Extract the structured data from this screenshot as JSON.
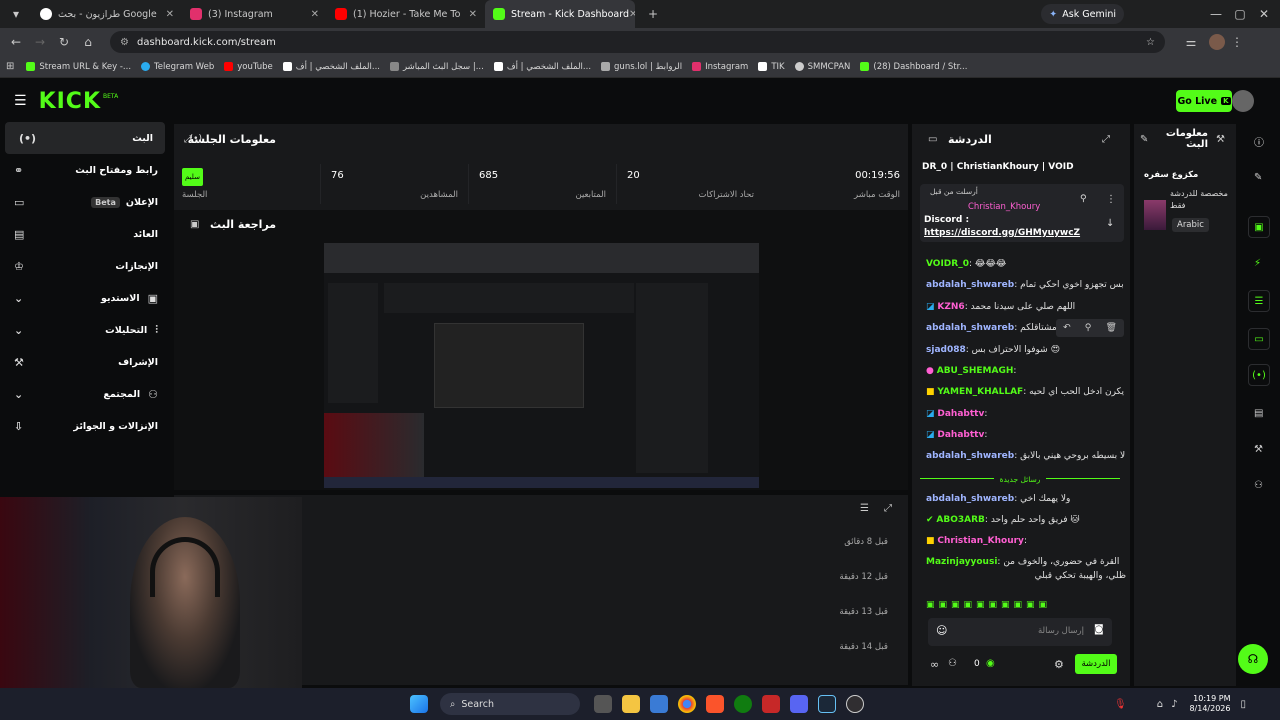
{
  "browser": {
    "tabs": [
      {
        "title": "طرازيون - بحث Google",
        "color": "#ffffff"
      },
      {
        "title": "(3) Instagram",
        "color": "#e1306c"
      },
      {
        "title": "(1) Hozier - Take Me To Ch...",
        "color": "#ff0000"
      },
      {
        "title": "Stream - Kick Dashboard",
        "color": "#53fc18"
      }
    ],
    "ask_gemini": "Ask Gemini",
    "url": "dashboard.kick.com/stream",
    "bookmarks": [
      {
        "label": "Stream URL & Key -...",
        "color": "#53fc18"
      },
      {
        "label": "Telegram Web",
        "color": "#2aabee"
      },
      {
        "label": "youTube",
        "color": "#ff0000"
      },
      {
        "label": "الملف الشخصي | أف...",
        "color": "#ffffff"
      },
      {
        "label": "سجل البث المباشر |...",
        "color": "#888888"
      },
      {
        "label": "الملف الشخصي | أف...",
        "color": "#ffffff"
      },
      {
        "label": "guns.lol | الروابط",
        "color": "#aaaaaa"
      },
      {
        "label": "Instagram",
        "color": "#e1306c"
      },
      {
        "label": "TIK",
        "color": "#ffffff"
      },
      {
        "label": "SMMCPAN",
        "color": "#cccccc"
      },
      {
        "label": "(28) Dashboard / Str...",
        "color": "#53fc18"
      }
    ]
  },
  "header": {
    "logo": "KICK",
    "beta": "BETA",
    "go_live": "Go Live"
  },
  "sidebar": {
    "items": [
      {
        "label": "البث",
        "icon": "live-icon"
      },
      {
        "label": "رابط ومفتاح البث",
        "icon": "link-icon"
      },
      {
        "label": "الإعلان",
        "icon": "ad-icon",
        "badge": "Beta"
      },
      {
        "label": "العائد",
        "icon": "revenue-icon"
      },
      {
        "label": "الإنجازات",
        "icon": "trophy-icon"
      },
      {
        "label": "الاستديو",
        "icon": "studio-icon"
      },
      {
        "label": "التحليلات",
        "icon": "analytics-icon"
      },
      {
        "label": "الإشراف",
        "icon": "moderation-icon"
      },
      {
        "label": "المجتمع",
        "icon": "community-icon"
      },
      {
        "label": "الإنزالات و الجوائز",
        "icon": "drops-icon"
      }
    ]
  },
  "session": {
    "title": "معلومات الجلسة",
    "stats": [
      {
        "value": "00:19:56",
        "label": "الوقت مباشر"
      },
      {
        "value": "20",
        "label": "تحاد الاشتراكات"
      },
      {
        "value": "685",
        "label": "المتابعين"
      },
      {
        "value": "76",
        "label": "المشاهدين"
      }
    ],
    "session_badge": "سليم",
    "session_label": "الجلسة"
  },
  "preview": {
    "title": "مراجعة البث"
  },
  "activity": {
    "rows": [
      "قبل 8 دقائق",
      "قبل 12 دقيقة",
      "قبل 13 دقيقة",
      "قبل 14 دقيقة"
    ]
  },
  "chat": {
    "title": "الدردشة",
    "top_users": "DR_0 | ChristianKhoury | VOID",
    "pinned_by": "أرسلت من قبل",
    "pinned_user": "Christian_Khoury",
    "pinned_text": "Discord :",
    "pinned_link": "https://discord.gg/GHMyuywcZ",
    "messages": [
      {
        "user": "VOIDR_0",
        "text": "😂😂😂",
        "color": "#53fc18"
      },
      {
        "user": "abdalah_shwareb",
        "text": "بس تجهزو اخوي احكي تمام",
        "color": "#9fb5ff"
      },
      {
        "user": "KZN6",
        "text": "اللهم صلي على سيدنا محمد",
        "color": "#ff5fd2"
      },
      {
        "user": "abdalah_shwareb",
        "text": "احنا مشتاقلكم",
        "color": "#9fb5ff"
      },
      {
        "user": "sjad088",
        "text": "شوفوا الاحتراف بس 😍",
        "color": "#9fb5ff"
      },
      {
        "user": "ABU_SHEMAGH",
        "text": "",
        "color": "#53fc18"
      },
      {
        "user": "YAMEN_KHALLAF",
        "text": "يكرن ادخل الحب اي لحيه",
        "color": "#53fc18"
      },
      {
        "user": "Dahabttv",
        "text": "",
        "color": "#ff5fd2"
      },
      {
        "user": "Dahabttv",
        "text": "",
        "color": "#ff5fd2"
      },
      {
        "user": "abdalah_shwareb",
        "text": "لا بسيطه بروحي هيني بالابق",
        "color": "#9fb5ff"
      },
      {
        "user": "abdalah_shwareb",
        "text": "ولا يهمك اخي",
        "color": "#9fb5ff"
      },
      {
        "user": "ABO3ARB",
        "text": "فريق واحد حلم واحد 🐱",
        "color": "#53fc18"
      },
      {
        "user": "Christian_Khoury",
        "text": "",
        "color": "#ff5fd2"
      },
      {
        "user": "Mazinjayyousi",
        "text": "القرة في حضوري، والخوف من",
        "color": "#53fc18"
      },
      {
        "user": "",
        "text": "ظلّي، والهيبة تحكي قبلي",
        "color": "#ffffff"
      }
    ],
    "new_messages": "رسائل جديدة",
    "input_placeholder": "إرسال رسالة",
    "count": "0",
    "send_label": "الدردشة"
  },
  "stream_info": {
    "title": "معلومات البث",
    "category": "مكزوع سفره",
    "desc": "مخصصة للدردشة فقط",
    "language": "Arabic"
  },
  "taskbar": {
    "search": "Search",
    "time": "10:19 PM",
    "date": "8/14/2026"
  },
  "colors": {
    "accent": "#53fc18",
    "panel": "#18191b",
    "bg": "#0b0c0d"
  }
}
